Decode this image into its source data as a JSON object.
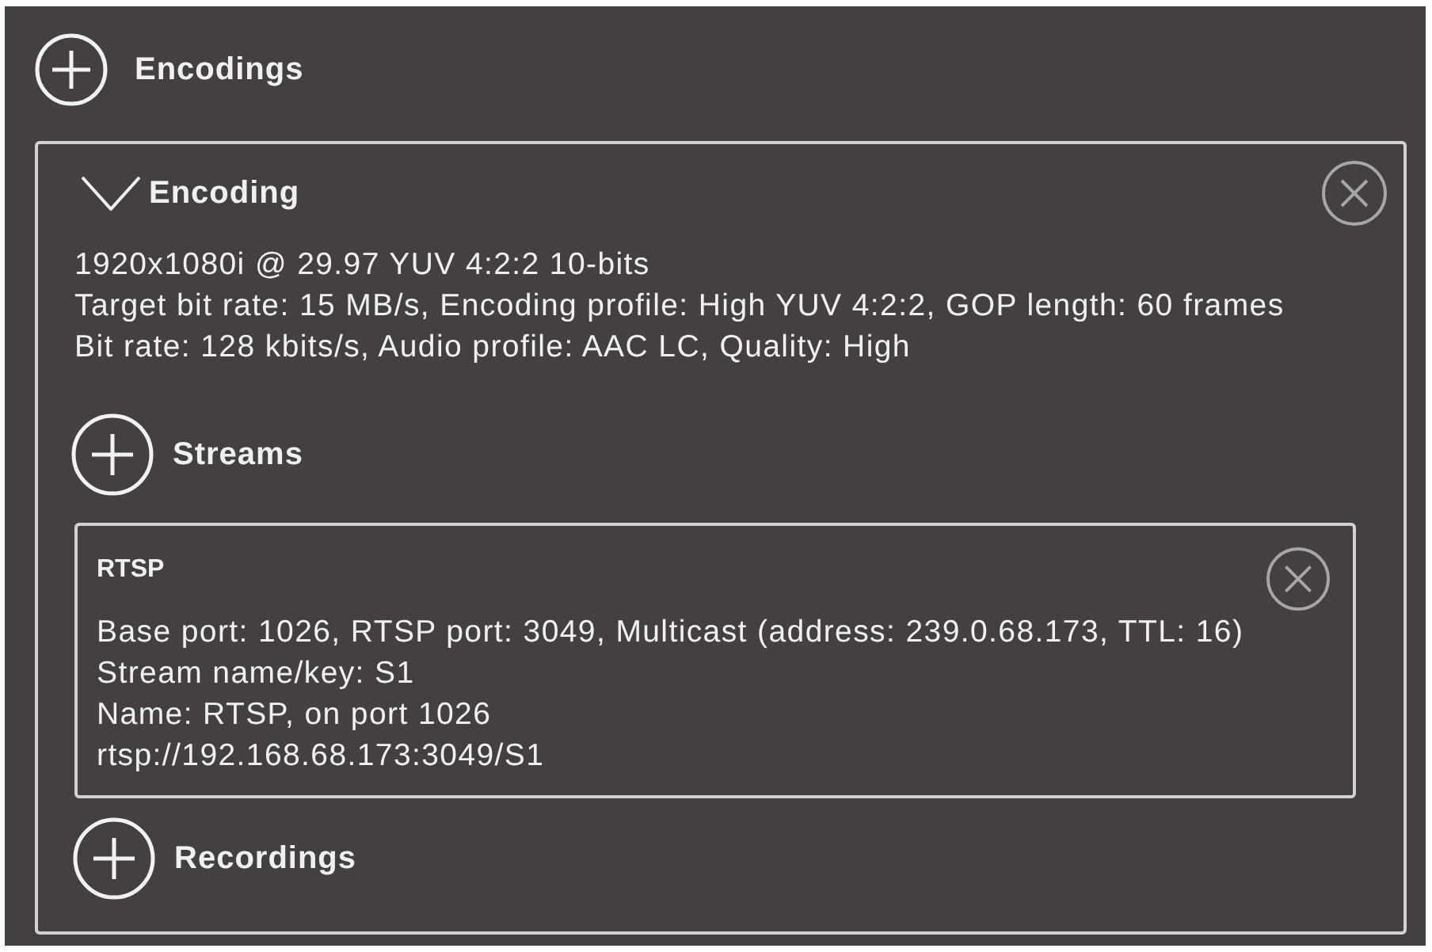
{
  "encodings_header": {
    "label": "Encodings"
  },
  "encoding": {
    "title": "Encoding",
    "expanded": true,
    "details": [
      "1920x1080i @ 29.97 YUV 4:2:2 10-bits",
      "Target bit rate: 15 MB/s, Encoding profile: High YUV 4:2:2, GOP length: 60 frames",
      "Bit rate: 128 kbits/s, Audio profile: AAC LC, Quality: High"
    ],
    "streams_header": {
      "label": "Streams"
    },
    "streams": [
      {
        "title": "RTSP",
        "details": [
          "Base port: 1026, RTSP port: 3049, Multicast (address: 239.0.68.173, TTL: 16)",
          "Stream name/key: S1",
          "Name: RTSP, on port 1026",
          "rtsp://192.168.68.173:3049/S1"
        ]
      }
    ],
    "recordings_header": {
      "label": "Recordings"
    }
  }
}
